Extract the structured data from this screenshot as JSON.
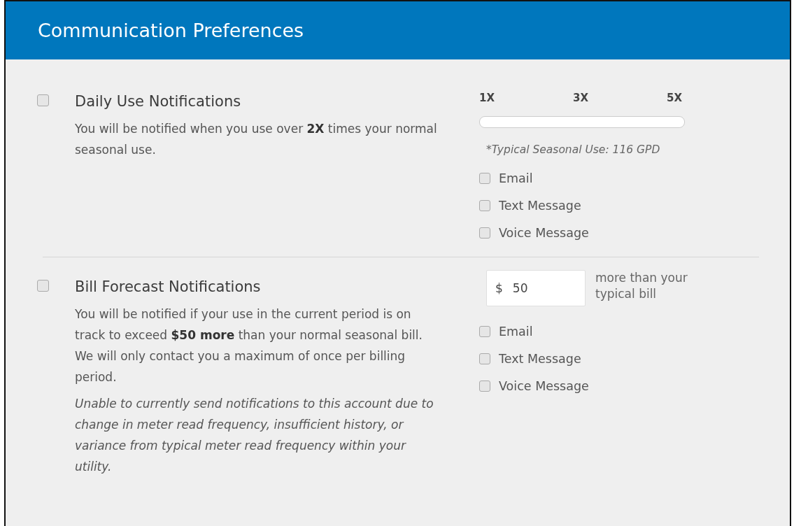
{
  "header": {
    "title": "Communication Preferences"
  },
  "sections": [
    {
      "kind": "slider",
      "checked": false,
      "title": "Daily Use Notifications",
      "description": "You will be notified when you use over **2X** times your normal seasonal use.",
      "scale": [
        "1X",
        "3X",
        "5X"
      ],
      "note": "*Typical Seasonal Use: 116 GPD",
      "channels": [
        {
          "label": "Email",
          "checked": false
        },
        {
          "label": "Text Message",
          "checked": false
        },
        {
          "label": "Voice Message",
          "checked": false
        }
      ]
    },
    {
      "kind": "amount",
      "checked": false,
      "title": "Bill Forecast Notifications",
      "description": "You will be notified if your use in the current period is on track to exceed **$50 more** than your normal seasonal bill. We will only contact you a maximum of once per billing period.",
      "warning": "Unable to currently send notifications to this account due to change in meter read frequency, insufficient history, or variance from typical meter read frequency within your utility.",
      "currency": "$",
      "amount": "50",
      "amount_label": "more than your typical bill",
      "channels": [
        {
          "label": "Email",
          "checked": false
        },
        {
          "label": "Text Message",
          "checked": false
        },
        {
          "label": "Voice Message",
          "checked": false
        }
      ]
    }
  ]
}
